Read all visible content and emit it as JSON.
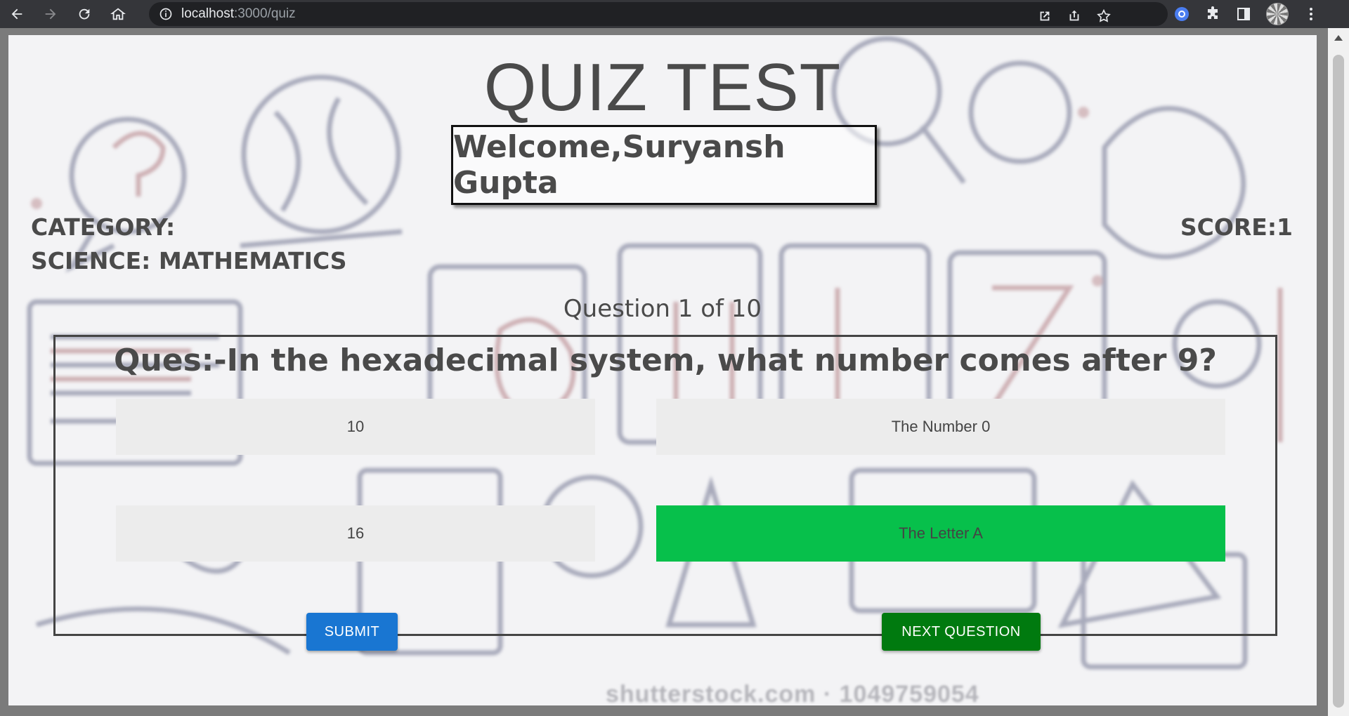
{
  "browser": {
    "url_host": "localhost",
    "url_path": ":3000/quiz"
  },
  "quiz": {
    "title": "QUIZ TEST",
    "welcome": "Welcome,Suryansh Gupta",
    "category_label": "CATEGORY:",
    "category_value": "SCIENCE: MATHEMATICS",
    "score": "SCORE:1",
    "question_counter": "Question 1 of 10",
    "question": "Ques:-In the hexadecimal system, what number comes after 9?",
    "options": [
      {
        "label": "10",
        "state": "default"
      },
      {
        "label": "The Number 0",
        "state": "default"
      },
      {
        "label": "16",
        "state": "default"
      },
      {
        "label": "The Letter A",
        "state": "correct"
      }
    ],
    "submit_label": "SUBMIT",
    "next_label": "NEXT QUESTION"
  },
  "watermark": "shutterstock.com · 1049759054",
  "colors": {
    "correct": "#07c04b",
    "submit": "#1976d2",
    "next": "#007a0f"
  }
}
